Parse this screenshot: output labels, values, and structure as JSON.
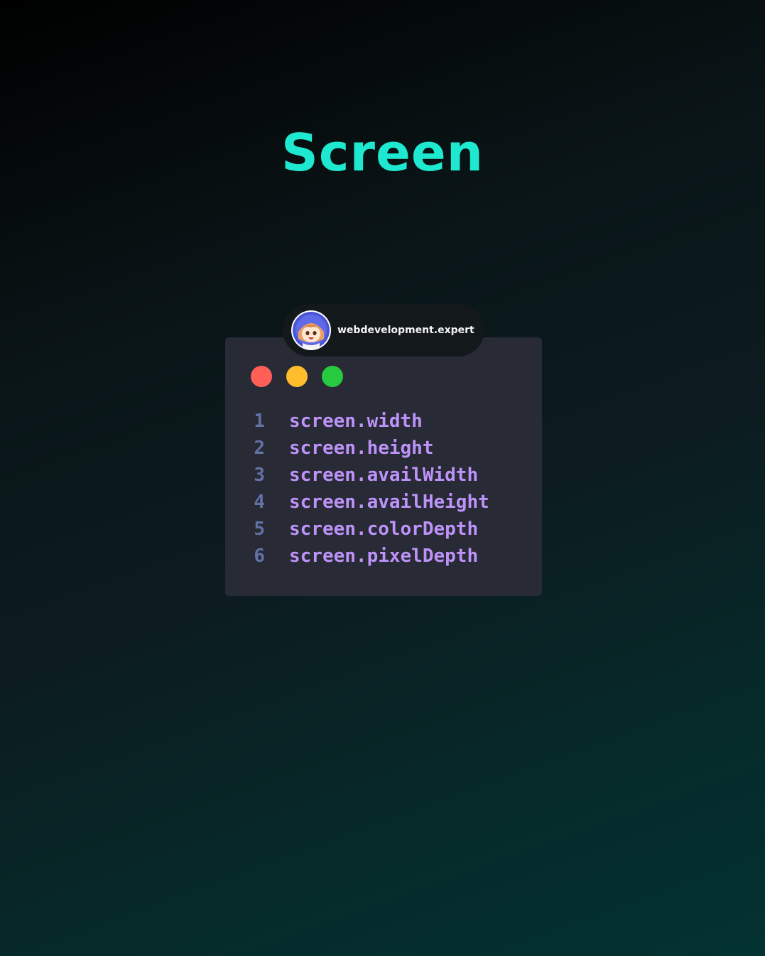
{
  "title": "Screen",
  "author": {
    "handle": "webdevelopment.expert",
    "avatar_icon": "anime-avatar-icon"
  },
  "window": {
    "controls": [
      {
        "name": "close",
        "color": "#ff5f56"
      },
      {
        "name": "minimize",
        "color": "#ffbd2e"
      },
      {
        "name": "maximize",
        "color": "#27c93f"
      }
    ]
  },
  "code": {
    "lines": [
      {
        "number": "1",
        "text": "screen.width"
      },
      {
        "number": "2",
        "text": "screen.height"
      },
      {
        "number": "3",
        "text": "screen.availWidth"
      },
      {
        "number": "4",
        "text": "screen.availHeight"
      },
      {
        "number": "5",
        "text": "screen.colorDepth"
      },
      {
        "number": "6",
        "text": "screen.pixelDepth"
      }
    ]
  },
  "colors": {
    "title": "#1ee8cf",
    "code_text": "#bd93f9",
    "line_number": "#6272a4",
    "window_bg": "#282a36"
  }
}
